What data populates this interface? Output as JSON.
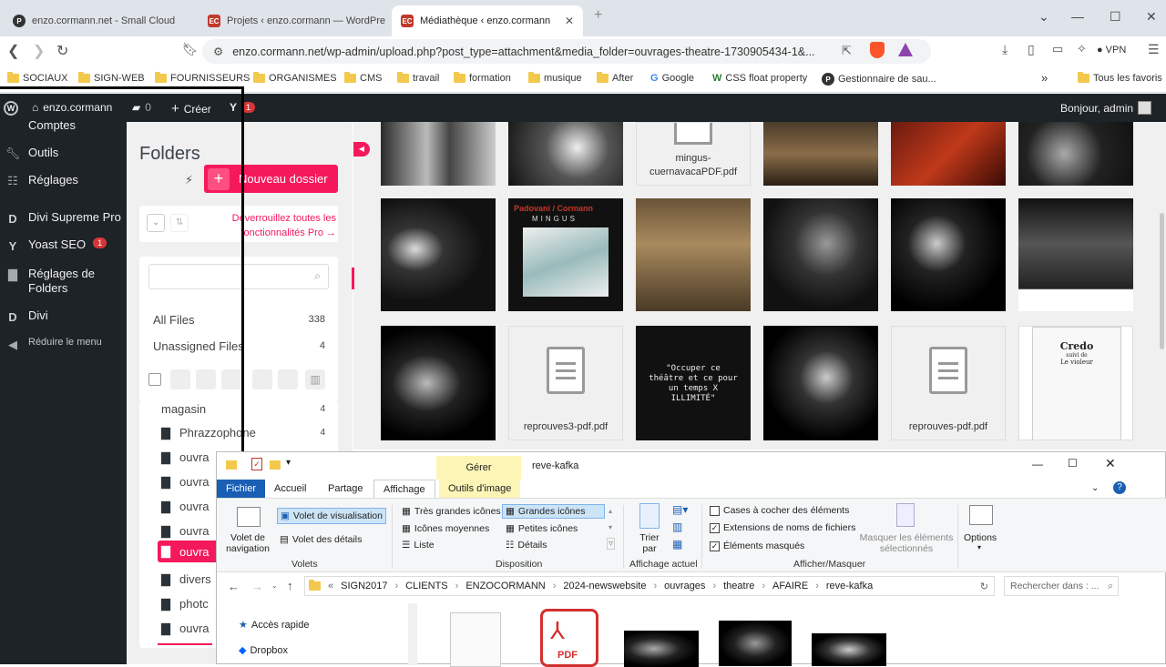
{
  "browser": {
    "tabs": [
      {
        "title": "enzo.cormann.net - Small Cloud",
        "favicon": "P"
      },
      {
        "title": "Projets ‹ enzo.cormann — WordPre",
        "favicon": "EC"
      },
      {
        "title": "Médiathèque ‹ enzo.cormann",
        "favicon": "EC"
      }
    ],
    "new_tab_symbol": "+",
    "url": "enzo.cormann.net/wp-admin/upload.php?post_type=attachment&media_folder=ouvrages-theatre-1730905434-1&...",
    "vpn_label": "VPN"
  },
  "bookmarks": {
    "items": [
      "SOCIAUX",
      "SIGN-WEB",
      "FOURNISSEURS",
      "ORGANISMES",
      "CMS",
      "travail",
      "formation",
      "musique",
      "After",
      "Google",
      "CSS float property",
      "Gestionnaire de sau..."
    ],
    "overflow": "»",
    "all_favorites": "Tous les favoris"
  },
  "adminbar": {
    "site": "enzo.cormann",
    "comments_count": "0",
    "create_label": "Créer",
    "yoast_badge": "1",
    "greeting": "Bonjour, admin"
  },
  "menu": {
    "items": [
      {
        "label": "Comptes",
        "icon": "user-icon"
      },
      {
        "label": "Outils",
        "icon": "wrench-icon"
      },
      {
        "label": "Réglages",
        "icon": "sliders-icon"
      },
      {
        "label": "Divi Supreme Pro",
        "icon": "divi-icon"
      },
      {
        "label": "Yoast SEO",
        "icon": "yoast-icon",
        "badge": "1"
      },
      {
        "label": "Réglages de Folders",
        "icon": "folder-icon"
      },
      {
        "label": "Divi",
        "icon": "divi-icon"
      },
      {
        "label": "Réduire le menu",
        "icon": "collapse-icon"
      }
    ]
  },
  "folders": {
    "title": "Folders",
    "new_button": "Nouveau dossier",
    "pro_notice": "Déverrouillez toutes les fonctionnalités Pro →",
    "all_files": {
      "label": "All Files",
      "count": "338"
    },
    "unassigned": {
      "label": "Unassigned Files",
      "count": "4"
    },
    "tree": [
      {
        "label": "magasin",
        "count": "4"
      },
      {
        "label": "Phrazzophone",
        "count": "4"
      },
      {
        "label": "ouvra",
        "count": ""
      },
      {
        "label": "ouvra",
        "count": ""
      },
      {
        "label": "ouvra",
        "count": ""
      },
      {
        "label": "ouvra",
        "count": ""
      },
      {
        "label": "ouvra",
        "count": "",
        "active": true
      },
      {
        "label": "divers",
        "count": ""
      },
      {
        "label": "photc",
        "count": ""
      },
      {
        "label": "ouvra",
        "count": ""
      }
    ]
  },
  "media": {
    "row0_doc": "mingus-cuernavacaPDF.pdf",
    "docs": [
      "reprouves3-pdf.pdf",
      "reprouves-pdf.pdf"
    ],
    "quote_text": "\"Occuper ce théâtre et ce pour un temps X ILLIMITÉ\"",
    "album_title": "Padovani / Cormann",
    "album_sub": "MINGUS",
    "credo_title": "Credo",
    "credo_sub": "suivi de",
    "credo_sub2": "Le violeur"
  },
  "explorer": {
    "title": "reve-kafka",
    "manage_tab": "Gérer",
    "tabs": [
      "Fichier",
      "Accueil",
      "Partage",
      "Affichage",
      "Outils d'image"
    ],
    "ribbon": {
      "panneau_nav": "Volet de navigation",
      "volet_visu": "Volet de visualisation",
      "volet_details": "Volet des détails",
      "volets_group": "Volets",
      "layout": [
        "Très grandes icônes",
        "Grandes icônes",
        "Icônes moyennes",
        "Petites icônes",
        "Liste",
        "Détails"
      ],
      "disposition_group": "Disposition",
      "sort": "Trier par",
      "affichage_actuel": "Affichage actuel",
      "cases": "Cases à cocher des éléments",
      "extensions": "Extensions de noms de fichiers",
      "masques": "Éléments masqués",
      "masquer_sel": "Masquer les éléments sélectionnés",
      "afficher_group": "Afficher/Masquer",
      "options": "Options"
    },
    "breadcrumb": [
      "SIGN2017",
      "CLIENTS",
      "ENZOCORMANN",
      "2024-newswebsite",
      "ouvrages",
      "theatre",
      "AFAIRE",
      "reve-kafka"
    ],
    "search_placeholder": "Rechercher dans : ...",
    "nav_items": [
      "Accès rapide",
      "Dropbox"
    ],
    "pdf_label": "PDF"
  }
}
